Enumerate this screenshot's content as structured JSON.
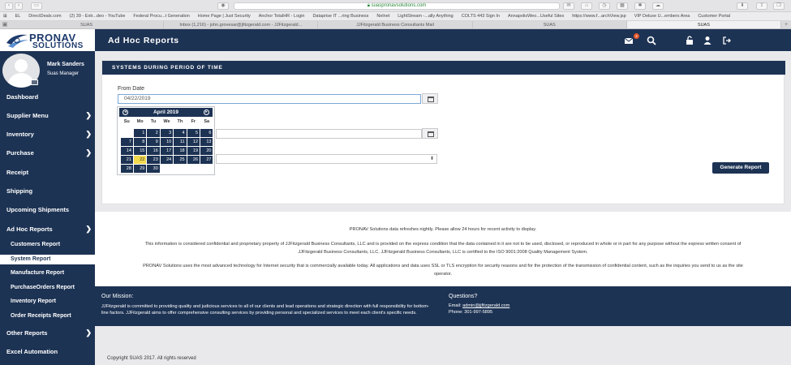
{
  "browser": {
    "url": "suaspronavsolutions.com",
    "bookmarks": [
      "EL",
      "DirectDeals.com",
      "(2) 39 - Extr...deo - YouTube",
      "Federal Procu...t Generation",
      "Home Page | Just Security",
      "Anchor TotalHR - Login",
      "Dataprise IT ...ring Business",
      "Nelnet",
      "LightStream -...ally Anything",
      "COLTS 443 Sign In",
      "AnnapolisWeo...Useful Sites",
      "https://www.f...archView.jsp",
      "VIP Deluxe U...embers Area",
      "Customer Portal"
    ],
    "tabs": [
      "SUAS",
      "Inbox (1,216) - john.grovesar@jfitzgerald.com - JJFitzgerald...",
      "JJFitzgerald Business Consultants Mail",
      "SUAS",
      "SUAS"
    ],
    "active_tab": 4,
    "new_tab": "+"
  },
  "brand": {
    "line1": "PRONAV",
    "line2": "SOLUTIONS"
  },
  "user": {
    "name": "Mark Sanders",
    "role": "Suas Manager"
  },
  "nav": {
    "dashboard": "Dashboard",
    "supplier_menu": "Supplier Menu",
    "inventory": "Inventory",
    "purchase": "Purchase",
    "receipt": "Receipt",
    "shipping": "Shipping",
    "upcoming": "Upcoming Shipments",
    "adhoc": "Ad Hoc Reports",
    "customers_report": "Customers Report",
    "system_report": "System Report",
    "manufacture_report": "Manufacture Report",
    "purchaseorders_report": "PurchaseOrders Report",
    "inventory_report": "Inventory Report",
    "order_receipts_report": "Order Receipts Report",
    "other_reports": "Other Reports",
    "excel_automation": "Excel Automation",
    "chevron": "❯"
  },
  "header": {
    "title": "Ad Hoc Reports",
    "mail_count": "4"
  },
  "card": {
    "title": "SYSTEMS DURING PERIOD OF TIME",
    "from_label": "From Date",
    "from_value": "04/22/2019",
    "generate_label": "Generate Report",
    "select_arrow": "⬍"
  },
  "datepicker": {
    "month": "April 2019",
    "prev": "◂",
    "next": "▸",
    "dows": [
      "Su",
      "Mo",
      "Tu",
      "We",
      "Th",
      "Fr",
      "Sa"
    ],
    "weeks": [
      [
        "",
        "1",
        "2",
        "3",
        "4",
        "5",
        "6"
      ],
      [
        "7",
        "8",
        "9",
        "10",
        "11",
        "12",
        "13"
      ],
      [
        "14",
        "15",
        "16",
        "17",
        "18",
        "19",
        "20"
      ],
      [
        "21",
        "22",
        "23",
        "24",
        "25",
        "26",
        "27"
      ],
      [
        "28",
        "29",
        "30",
        "",
        "",
        "",
        ""
      ]
    ],
    "today": "22"
  },
  "info": {
    "refresh": "PRONAV Solutions data refreshes nightly. Please allow 24 hours for recent activity to display.",
    "confidential1": "This information is considered confidential and proprietary property of JJFitzgerald Business Consultants, LLC and is provided on the express condition that the data contained in it are not to be used, disclosed, or reproduced in whole or in part for any purpose without the express written consent of",
    "confidential2": "JJFitzgerald Business Consultants, LLC. JJFitzgerald Business Consultants, LLC is certified to the ISO 9001:2008 Quality Management System.",
    "security1": "PRONAV Solutions uses the most advanced technology for Internet security that is commercially available today. All applications and data uses SSL or TLS encryption for security reasons and for the protection of the transmission of confidential content, such as the inquiries you send to us as the site",
    "security2": "operator."
  },
  "footer": {
    "mission_heading": "Our Mission:",
    "mission_text": "JJFitzgerald is committed to providing quality and judicious services to all of our clients and lead operations and strategic direction with full responsibility for bottom-line factors. JJFitzgerald aims to offer comprehensive consulting services by providing personal and specialized services to meet each client's specific needs.",
    "questions_heading": "Questions?",
    "email_label": "Email:",
    "email": "admin@jjfitzgerald.com",
    "phone_label": "Phone:",
    "phone": "301-997-5895",
    "copyright": "Copyright SUAS 2017. All rights reserved"
  },
  "colors": {
    "navy": "#1d3354",
    "highlight": "#f1d94d",
    "badge": "#e5572a"
  }
}
